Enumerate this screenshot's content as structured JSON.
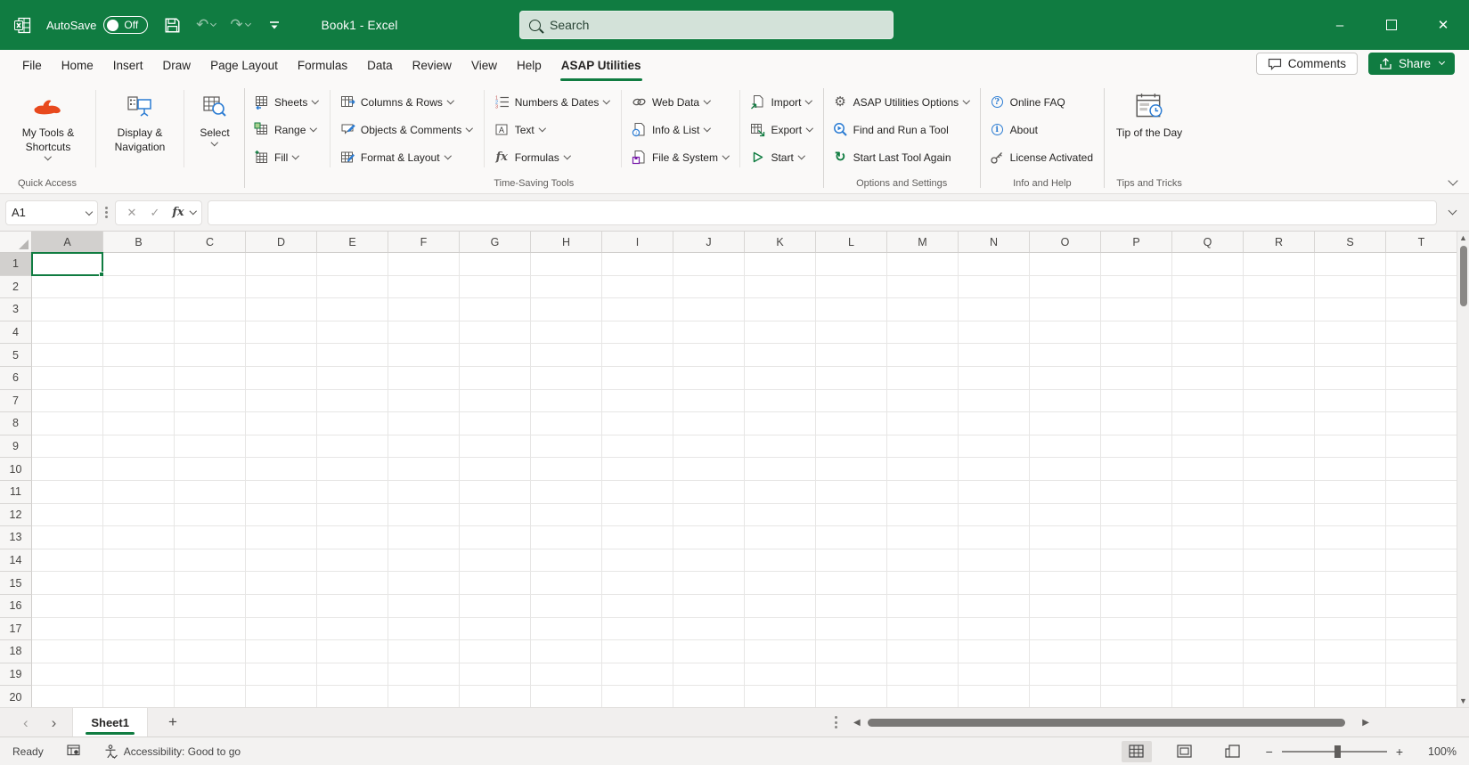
{
  "title_bar": {
    "autosave_label": "AutoSave",
    "autosave_state": "Off",
    "document_title": "Book1 - Excel",
    "search_placeholder": "Search"
  },
  "tabs": [
    "File",
    "Home",
    "Insert",
    "Draw",
    "Page Layout",
    "Formulas",
    "Data",
    "Review",
    "View",
    "Help",
    "ASAP Utilities"
  ],
  "active_tab": "ASAP Utilities",
  "top_right": {
    "comments": "Comments",
    "share": "Share"
  },
  "ribbon": {
    "groups": {
      "quick_access": "Quick Access",
      "time_saving": "Time-Saving Tools",
      "options": "Options and Settings",
      "info_help": "Info and Help",
      "tips": "Tips and Tricks"
    },
    "items": {
      "my_tools": "My Tools & Shortcuts",
      "display_navigation": "Display & Navigation",
      "select": "Select",
      "sheets": "Sheets",
      "range": "Range",
      "fill": "Fill",
      "columns_rows": "Columns & Rows",
      "objects_comments": "Objects & Comments",
      "format_layout": "Format & Layout",
      "numbers_dates": "Numbers & Dates",
      "text": "Text",
      "formulas": "Formulas",
      "web_data": "Web Data",
      "info_list": "Info & List",
      "file_system": "File & System",
      "import": "Import",
      "export": "Export",
      "start": "Start",
      "asap_options": "ASAP Utilities Options",
      "find_run": "Find and Run a Tool",
      "start_last": "Start Last Tool Again",
      "online_faq": "Online FAQ",
      "about": "About",
      "license": "License Activated",
      "tip_of_day": "Tip of the Day"
    }
  },
  "formula_bar": {
    "name_box": "A1",
    "formula_value": ""
  },
  "grid": {
    "columns": [
      "A",
      "B",
      "C",
      "D",
      "E",
      "F",
      "G",
      "H",
      "I",
      "J",
      "K",
      "L",
      "M",
      "N",
      "O",
      "P",
      "Q",
      "R",
      "S",
      "T"
    ],
    "rows": [
      1,
      2,
      3,
      4,
      5,
      6,
      7,
      8,
      9,
      10,
      11,
      12,
      13,
      14,
      15,
      16,
      17,
      18,
      19,
      20
    ],
    "selected_cell": "A1",
    "selected_column": "A",
    "selected_row": 1
  },
  "sheet_bar": {
    "tabs": [
      {
        "label": "Sheet1",
        "active": true
      }
    ]
  },
  "status_bar": {
    "ready": "Ready",
    "accessibility": "Accessibility: Good to go",
    "zoom_level": "100%"
  },
  "colors": {
    "accent_green": "#107C41",
    "icon_blue": "#2B7CD3",
    "logo_orange": "#E8491D",
    "icon_purple": "#7719AA"
  }
}
